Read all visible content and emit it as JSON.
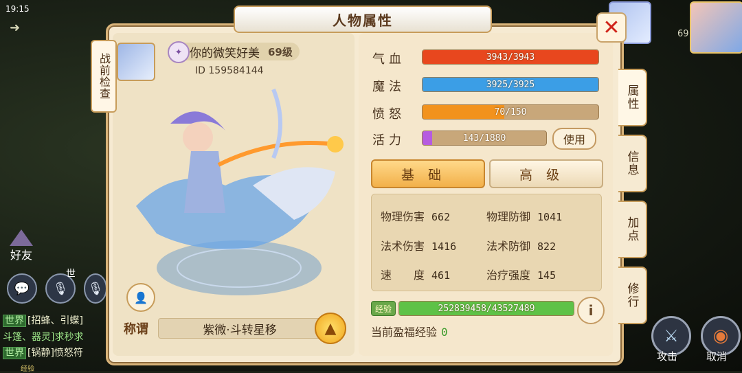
{
  "status_bar": {
    "time": "19:15"
  },
  "window": {
    "title": "人物属性",
    "close_icon": "close-icon"
  },
  "side_left": {
    "precheck_label": "战前检查"
  },
  "profile": {
    "name": "你的微笑好美",
    "level": "69级",
    "id_label": "ID",
    "id_value": "159584144"
  },
  "title_section": {
    "label": "称谓",
    "value": "紫微·斗转星移"
  },
  "stats": {
    "hp": {
      "label": "气血",
      "current": 3943,
      "max": 3943,
      "text": "3943/3943",
      "color": "#e8471e"
    },
    "mp": {
      "label": "魔法",
      "current": 3925,
      "max": 3925,
      "text": "3925/3925",
      "color": "#3b9ee6"
    },
    "rage": {
      "label": "愤怒",
      "current": 70,
      "max": 150,
      "text": "70/150",
      "color": "#f2921d"
    },
    "vitality": {
      "label": "活力",
      "current": 143,
      "max": 1880,
      "text": "143/1880",
      "color": "#b65be0"
    }
  },
  "use_button": "使用",
  "tabs": {
    "basic": "基础",
    "advanced": "高级"
  },
  "attributes": [
    {
      "label": "物理伤害",
      "value": "662"
    },
    {
      "label": "物理防御",
      "value": "1041"
    },
    {
      "label": "法术伤害",
      "value": "1416"
    },
    {
      "label": "法术防御",
      "value": "822"
    },
    {
      "label": "速　　度",
      "value": "461"
    },
    {
      "label": "治疗强度",
      "value": "145"
    }
  ],
  "experience": {
    "icon_label": "经验",
    "current": 252839458,
    "max": 43527489,
    "text": "252839458/43527489",
    "color": "#5ec247"
  },
  "blessed_exp": {
    "label": "当前盈福经验",
    "value": "0"
  },
  "side_tabs": [
    "属性",
    "信息",
    "加点",
    "修行"
  ],
  "chat": {
    "lines": [
      {
        "tag": "世界",
        "text": "[招蜂、引蝶]"
      },
      {
        "tag": "",
        "text": "斗篷、器灵]求秒求"
      },
      {
        "tag": "世界",
        "text": "[锅静]愤怒符"
      }
    ]
  },
  "hud": {
    "friends_label": "好友",
    "world_label": "世",
    "attack_label": "攻击",
    "cancel_label": "取消",
    "top_right_level": "69",
    "bottom_exp_label": "经验"
  }
}
